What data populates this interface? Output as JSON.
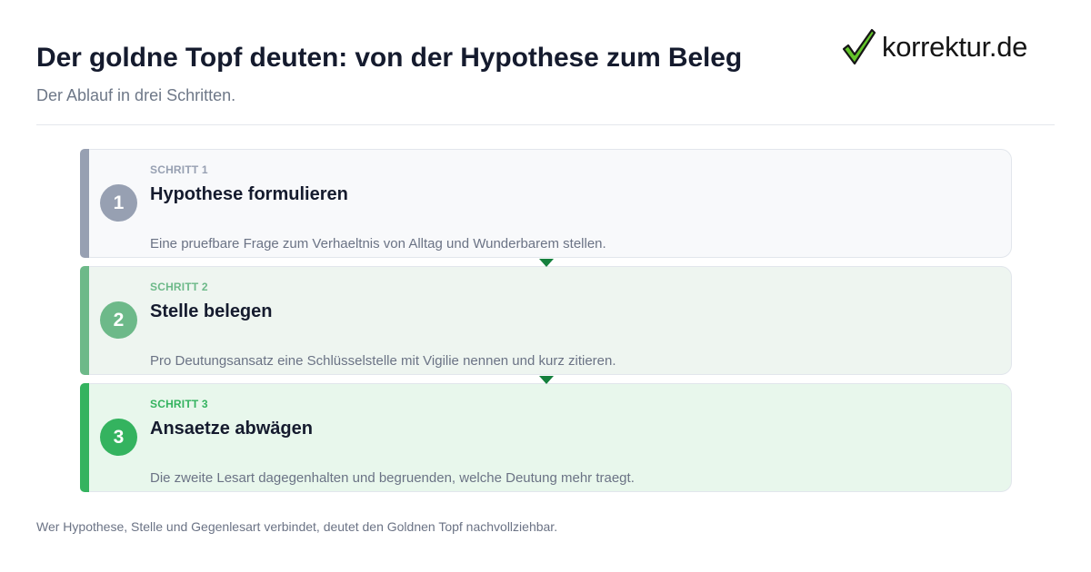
{
  "header": {
    "title": "Der goldne Topf deuten: von der Hypothese zum Beleg",
    "subtitle": "Der Ablauf in drei Schritten."
  },
  "logo": {
    "text": "korrektur.de",
    "icon": "checkmark-icon",
    "check_color": "#63c52a"
  },
  "steps": [
    {
      "number": "1",
      "label": "SCHRITT 1",
      "title": "Hypothese formulieren",
      "description": "Eine pruefbare Frage zum Verhaeltnis von Alltag und Wunderbarem stellen.",
      "accent": "#97a0b2"
    },
    {
      "number": "2",
      "label": "SCHRITT 2",
      "title": "Stelle belegen",
      "description": "Pro Deutungsansatz eine Schlüsselstelle mit Vigilie nennen und kurz zitieren.",
      "accent": "#6db989"
    },
    {
      "number": "3",
      "label": "SCHRITT 3",
      "title": "Ansaetze abwägen",
      "description": "Die zweite Lesart dagegenhalten und begruenden, welche Deutung mehr traegt.",
      "accent": "#34b35f"
    }
  ],
  "connector_color": "#15803d",
  "footer": {
    "text": "Wer Hypothese, Stelle und Gegenlesart verbindet, deutet den Goldnen Topf nachvollziehbar."
  }
}
